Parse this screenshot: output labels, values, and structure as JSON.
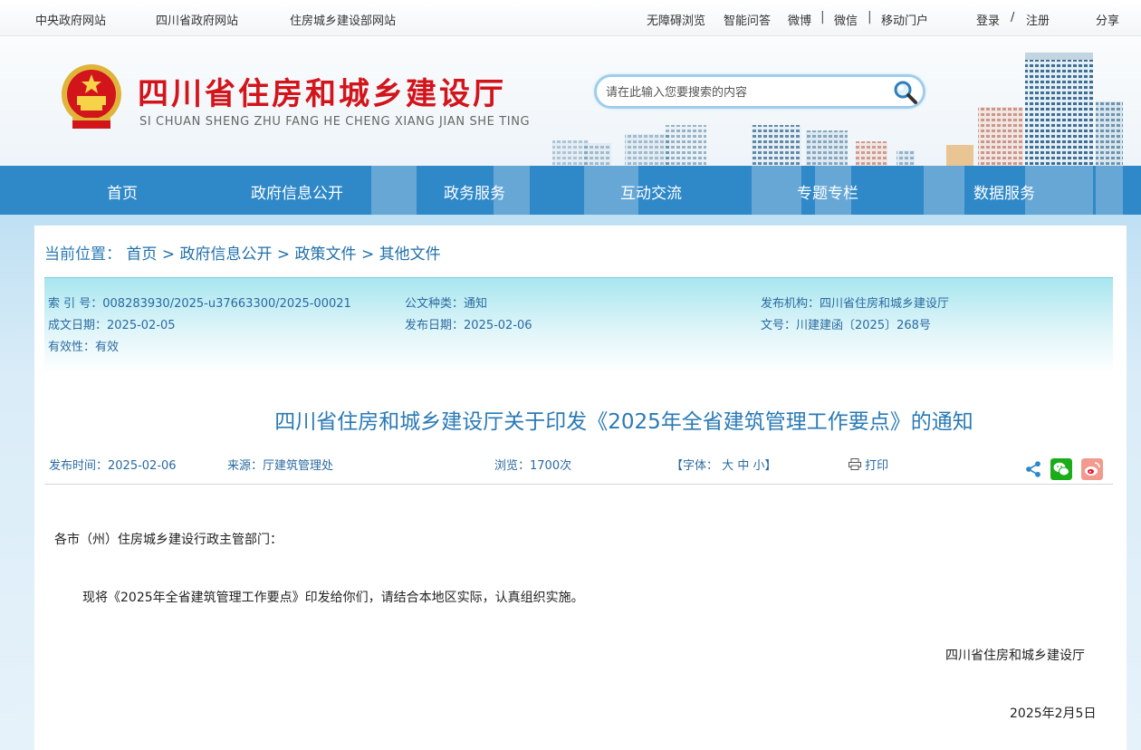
{
  "topbar": {
    "left_links": [
      "中央政府网站",
      "四川省政府网站",
      "住房城乡建设部网站"
    ],
    "right_links": [
      "无障碍浏览",
      "智能问答",
      "微博",
      "微信",
      "移动门户"
    ],
    "login": "登录",
    "slash": "/",
    "register": "注册",
    "share": "分享"
  },
  "header": {
    "title": "四川省住房和城乡建设厅",
    "subtitle": "SI CHUAN SHENG ZHU FANG HE CHENG XIANG JIAN SHE TING",
    "search_placeholder": "请在此输入您要搜索的内容"
  },
  "nav": {
    "items": [
      "首页",
      "政府信息公开",
      "政务服务",
      "互动交流",
      "专题专栏",
      "数据服务"
    ]
  },
  "breadcrumb": {
    "label": "当前位置：",
    "items": [
      "首页",
      "政府信息公开",
      "政策文件",
      "其他文件"
    ],
    "sep": ">"
  },
  "meta": {
    "index_no": "索 引 号：008283930/2025-u37663300/2025-00021",
    "category": "公文种类：通知",
    "publisher": "发布机构：四川省住房和城乡建设厅",
    "created": "成文日期：2025-02-05",
    "published": "发布日期：2025-02-06",
    "doc_no": "文号：川建建函〔2025〕268号",
    "validity": "有效性：有效"
  },
  "article": {
    "title": "四川省住房和城乡建设厅关于印发《2025年全省建筑管理工作要点》的通知",
    "time": "发布时间：2025-02-06",
    "source": "来源：厅建筑管理处",
    "views": "浏览：1700次",
    "font_label": "【字体：",
    "font_big": "大",
    "font_mid": "中",
    "font_small": "小",
    "font_end": "】",
    "print": "打印",
    "salutation": "各市（州）住房城乡建设行政主管部门：",
    "paragraph": "现将《2025年全省建筑管理工作要点》印发给你们，请结合本地区实际，认真组织实施。",
    "signature": "四川省住房和城乡建设厅",
    "date": "2025年2月5日"
  },
  "colors": {
    "nav_bg": "#2f88c8",
    "title_red": "#d2141b",
    "link_blue": "#2a7ab5",
    "wechat_green": "#1aad19",
    "weibo_red": "#e6162d"
  }
}
